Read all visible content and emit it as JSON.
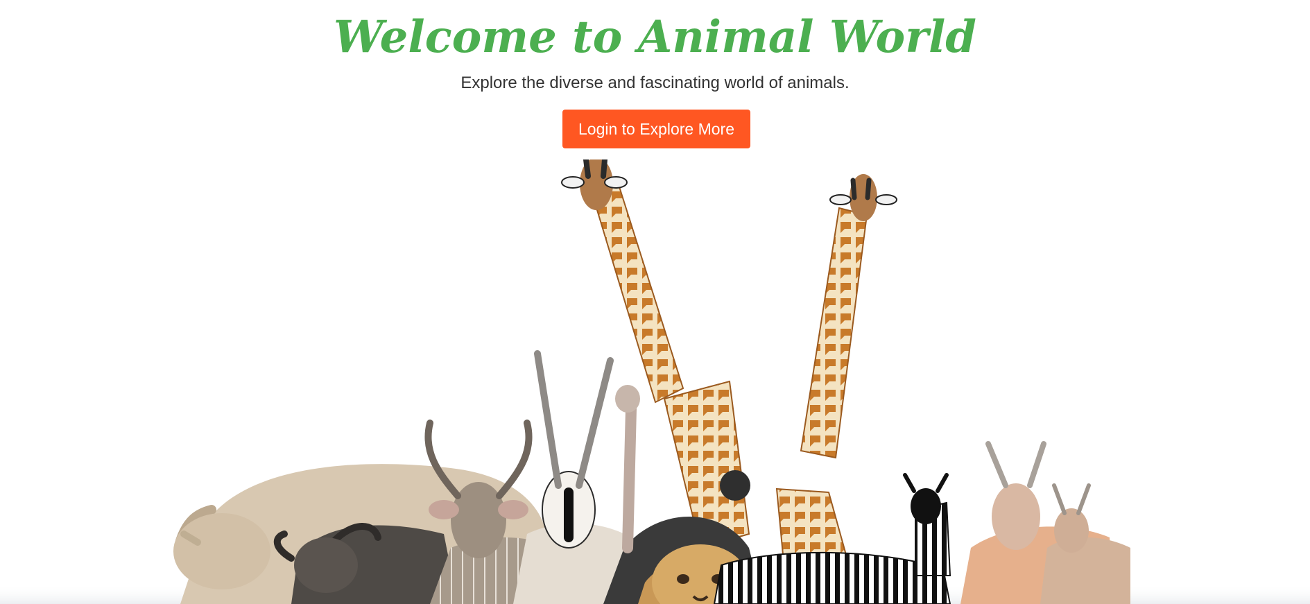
{
  "hero": {
    "title": "Welcome to Animal World",
    "subtitle": "Explore the diverse and fascinating world of animals.",
    "cta_label": "Login to Explore More"
  },
  "colors": {
    "title": "#4caf50",
    "subtitle": "#333333",
    "cta_background": "#ff5722",
    "cta_text": "#ffffff",
    "page_background": "#ffffff"
  },
  "illustration": {
    "subject": "animals-group-photo",
    "animals": [
      "giraffe",
      "giraffe",
      "kudu",
      "oryx",
      "ostrich",
      "rhino",
      "wildebeest",
      "lion",
      "zebra",
      "antelope",
      "gazelle"
    ]
  }
}
